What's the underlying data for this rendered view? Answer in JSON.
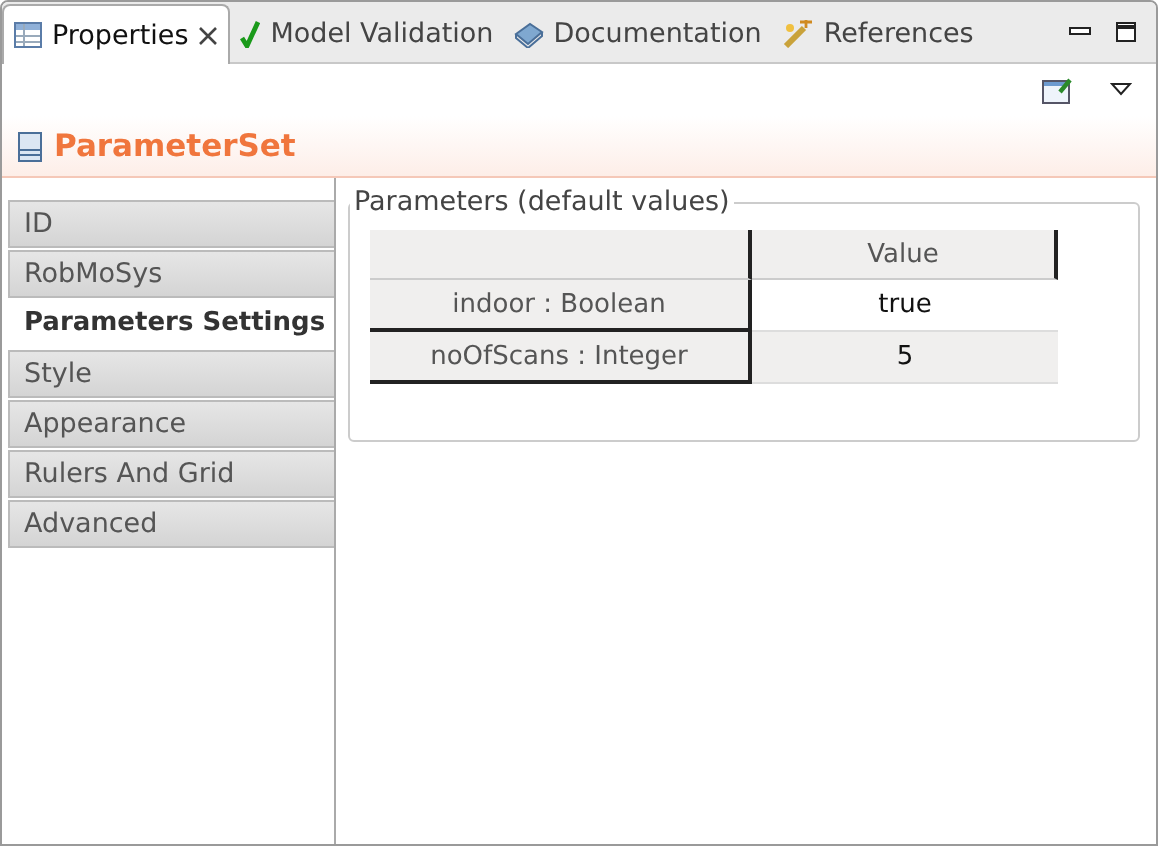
{
  "tabs": [
    {
      "label": "Properties",
      "kind": "table",
      "selected": true,
      "closable": true
    },
    {
      "label": "Model Validation",
      "kind": "check",
      "selected": false,
      "closable": false
    },
    {
      "label": "Documentation",
      "kind": "book",
      "selected": false,
      "closable": false
    },
    {
      "label": "References",
      "kind": "wand",
      "selected": false,
      "closable": false
    }
  ],
  "title": "ParameterSet",
  "sidebar": {
    "items": [
      {
        "label": "ID",
        "selected": false
      },
      {
        "label": "RobMoSys",
        "selected": false
      },
      {
        "label": "Parameters Settings",
        "selected": true
      },
      {
        "label": "Style",
        "selected": false
      },
      {
        "label": "Appearance",
        "selected": false
      },
      {
        "label": "Rulers And Grid",
        "selected": false
      },
      {
        "label": "Advanced",
        "selected": false
      }
    ]
  },
  "group": {
    "title": "Parameters (default values)",
    "table": {
      "columns": [
        "Value"
      ],
      "rows": [
        {
          "name": "indoor : Boolean",
          "value": "true",
          "selected": true
        },
        {
          "name": "noOfScans : Integer",
          "value": "5",
          "selected": false
        }
      ]
    }
  }
}
